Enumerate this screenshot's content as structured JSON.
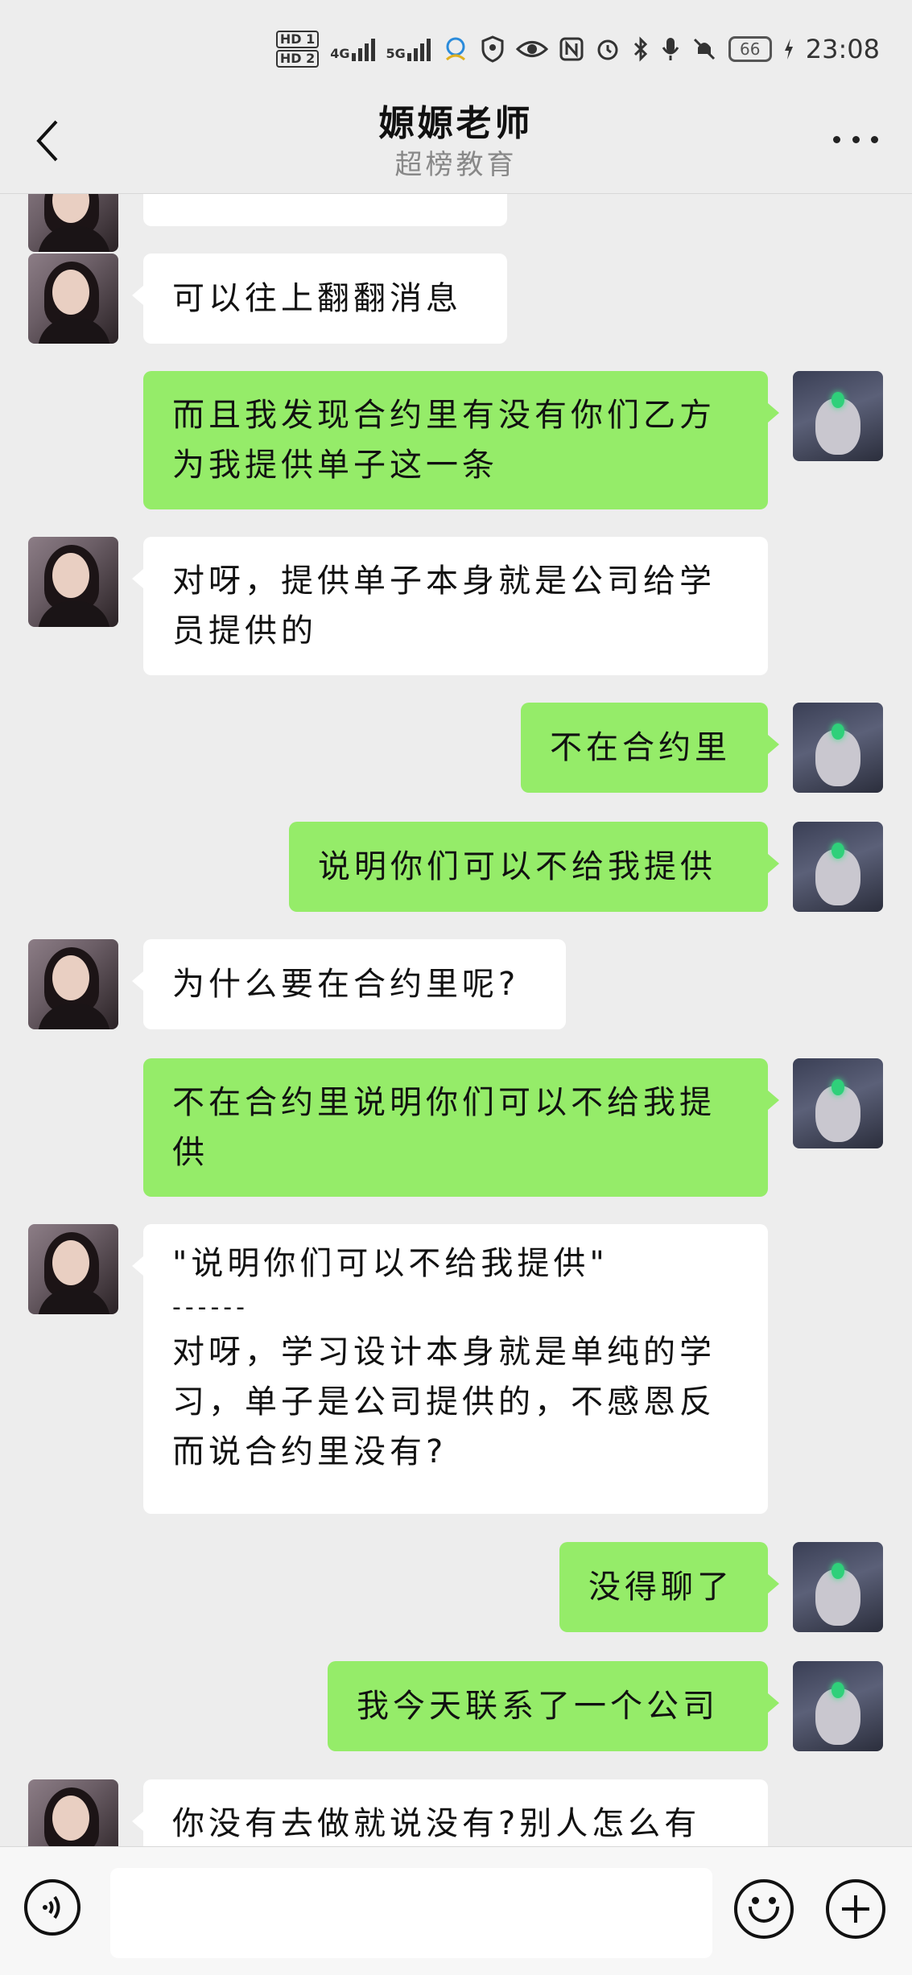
{
  "status_bar": {
    "hd1": "HD 1",
    "hd2": "HD 2",
    "net1": "4G",
    "net2": "5G",
    "battery": "66",
    "time": "23:08",
    "icons": [
      "signal-icon",
      "contact-app-icon",
      "shield-icon",
      "eye-icon",
      "nfc-icon",
      "alarm-icon",
      "bluetooth-icon",
      "mic-icon",
      "mute-icon",
      "charging-icon"
    ]
  },
  "header": {
    "title": "嫄嫄老师",
    "subtitle": "超榜教育",
    "back_icon": "chevron-left-icon",
    "more_icon": "more-dots-icon"
  },
  "messages": [
    {
      "side": "in",
      "lines": [
        "可以往上翻翻消息"
      ]
    },
    {
      "side": "out",
      "lines": [
        "而且我发现合约里有没有你们乙方",
        "为我提供单子这一条"
      ]
    },
    {
      "side": "in",
      "lines": [
        "对呀，提供单子本身就是公司给学",
        "员提供的"
      ]
    },
    {
      "side": "out",
      "lines": [
        "不在合约里"
      ]
    },
    {
      "side": "out",
      "lines": [
        "说明你们可以不给我提供"
      ]
    },
    {
      "side": "in",
      "lines": [
        "为什么要在合约里呢?"
      ]
    },
    {
      "side": "out",
      "lines": [
        "不在合约里说明你们可以不给我提",
        "供"
      ]
    },
    {
      "side": "in",
      "lines": [
        "\"说明你们可以不给我提供\"",
        "------",
        "对呀，学习设计本身就是单纯的学",
        "习，单子是公司提供的，不感恩反",
        "而说合约里没有?"
      ]
    },
    {
      "side": "out",
      "lines": [
        "没得聊了"
      ]
    },
    {
      "side": "out",
      "lines": [
        "我今天联系了一个公司"
      ]
    },
    {
      "side": "in",
      "lines": [
        "你没有去做就说没有?别人怎么有"
      ]
    }
  ],
  "input_bar": {
    "voice_icon": "voice-icon",
    "input_value": "",
    "emoji_icon": "emoji-icon",
    "plus_icon": "plus-icon"
  }
}
